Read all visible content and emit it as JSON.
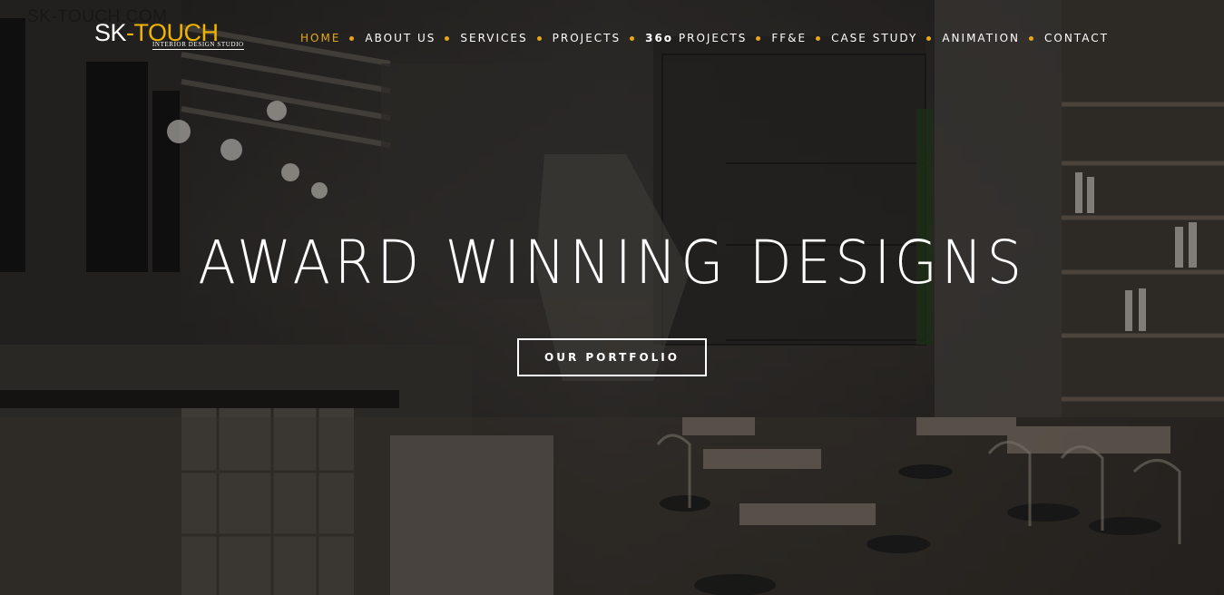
{
  "watermark": "SK-TOUCH.COM",
  "logo": {
    "main": "SK",
    "accent": "-TOUCH",
    "tagline": "INTERIOR DESIGN STUDIO"
  },
  "nav": {
    "items": [
      {
        "label": "HOME",
        "active": true
      },
      {
        "label": "ABOUT US"
      },
      {
        "label": "SERVICES"
      },
      {
        "label": "PROJECTS"
      },
      {
        "label_bold": "36o",
        "label": " PROJECTS"
      },
      {
        "label": "FF&E"
      },
      {
        "label": "CASE STUDY"
      },
      {
        "label": "ANIMATION"
      },
      {
        "label": "CONTACT"
      }
    ]
  },
  "hero": {
    "headline": "AWARD WINNING DESIGNS",
    "cta_label": "OUR PORTFOLIO"
  },
  "colors": {
    "accent": "#e6a817",
    "text": "#ffffff"
  }
}
